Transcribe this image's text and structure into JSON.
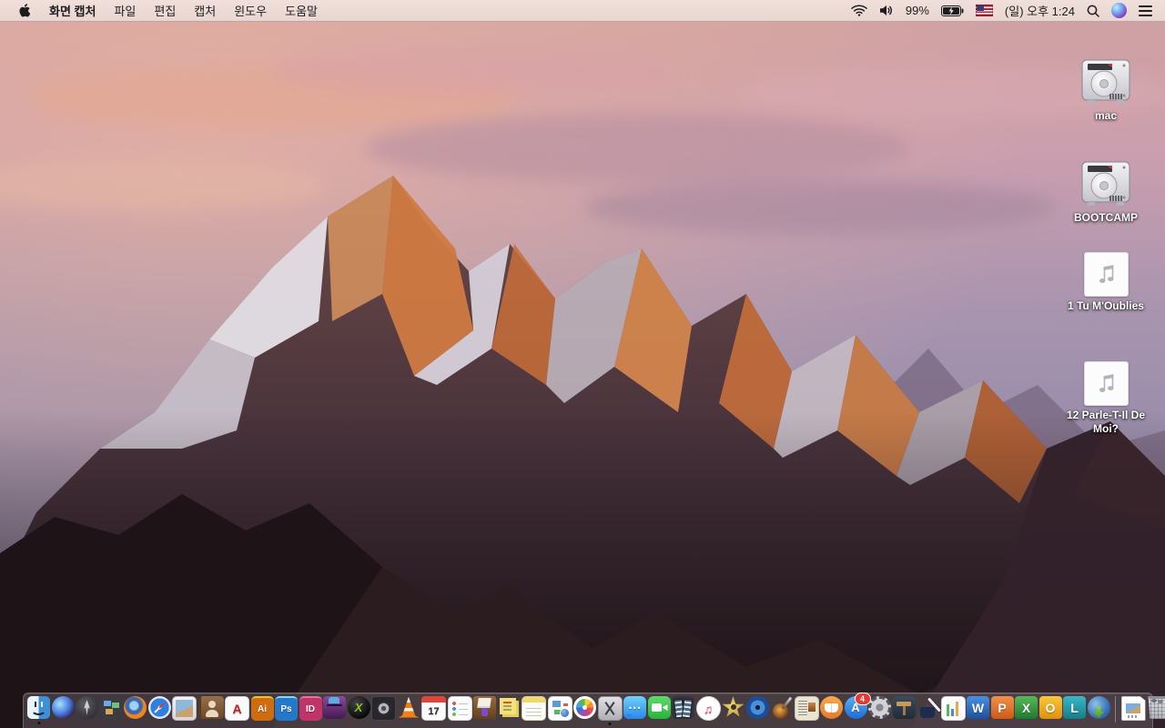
{
  "menu_bar": {
    "apple_logo": "apple-logo",
    "app_name": "화면 캡처",
    "menus": [
      "파일",
      "편집",
      "캡처",
      "윈도우",
      "도움말"
    ],
    "status": {
      "battery_percent": "99%",
      "clock": "(일) 오후 1:24",
      "icons": [
        "wifi",
        "volume",
        "battery-charging",
        "input-source-us-flag",
        "spotlight-search",
        "siri",
        "notification-center"
      ]
    }
  },
  "desktop": {
    "icons": [
      {
        "label": "mac",
        "type": "hard-drive"
      },
      {
        "label": "BOOTCAMP",
        "type": "hard-drive"
      },
      {
        "label": "1 Tu M'Oublies",
        "type": "audio-file"
      },
      {
        "label": "12 Parle-T-Il De Moi?",
        "type": "audio-file"
      }
    ]
  },
  "dock": {
    "items": [
      {
        "name": "finder",
        "running": true
      },
      {
        "name": "siri"
      },
      {
        "name": "launchpad"
      },
      {
        "name": "mission-control"
      },
      {
        "name": "firefox"
      },
      {
        "name": "safari"
      },
      {
        "name": "preview"
      },
      {
        "name": "contacts"
      },
      {
        "name": "acrobat",
        "glyph": "A"
      },
      {
        "name": "illustrator",
        "glyph": "Ai"
      },
      {
        "name": "photoshop",
        "glyph": "Ps"
      },
      {
        "name": "indesign",
        "glyph": "ID"
      },
      {
        "name": "toast"
      },
      {
        "name": "x-converter",
        "glyph": "X"
      },
      {
        "name": "fan-utility"
      },
      {
        "name": "vlc"
      },
      {
        "name": "calendar",
        "glyph": "17"
      },
      {
        "name": "reminders"
      },
      {
        "name": "organizer"
      },
      {
        "name": "stickies"
      },
      {
        "name": "notes"
      },
      {
        "name": "document-app"
      },
      {
        "name": "photos"
      },
      {
        "name": "grab",
        "running": true
      },
      {
        "name": "messages",
        "glyph": "…"
      },
      {
        "name": "facetime"
      },
      {
        "name": "photo-booth"
      },
      {
        "name": "itunes",
        "glyph": "♫"
      },
      {
        "name": "imovie"
      },
      {
        "name": "dvd-player"
      },
      {
        "name": "garageband"
      },
      {
        "name": "news-clipping"
      },
      {
        "name": "ibooks"
      },
      {
        "name": "app-store",
        "glyph": "A",
        "badge": "4"
      },
      {
        "name": "system-preferences"
      },
      {
        "name": "keynote"
      },
      {
        "name": "pages"
      },
      {
        "name": "numbers"
      },
      {
        "name": "word",
        "glyph": "W"
      },
      {
        "name": "powerpoint",
        "glyph": "P"
      },
      {
        "name": "excel",
        "glyph": "X"
      },
      {
        "name": "outlook",
        "glyph": "O"
      },
      {
        "name": "lync",
        "glyph": "L"
      },
      {
        "name": "downloader"
      },
      {
        "separator": true
      },
      {
        "name": "document-file"
      },
      {
        "name": "trash"
      }
    ]
  }
}
